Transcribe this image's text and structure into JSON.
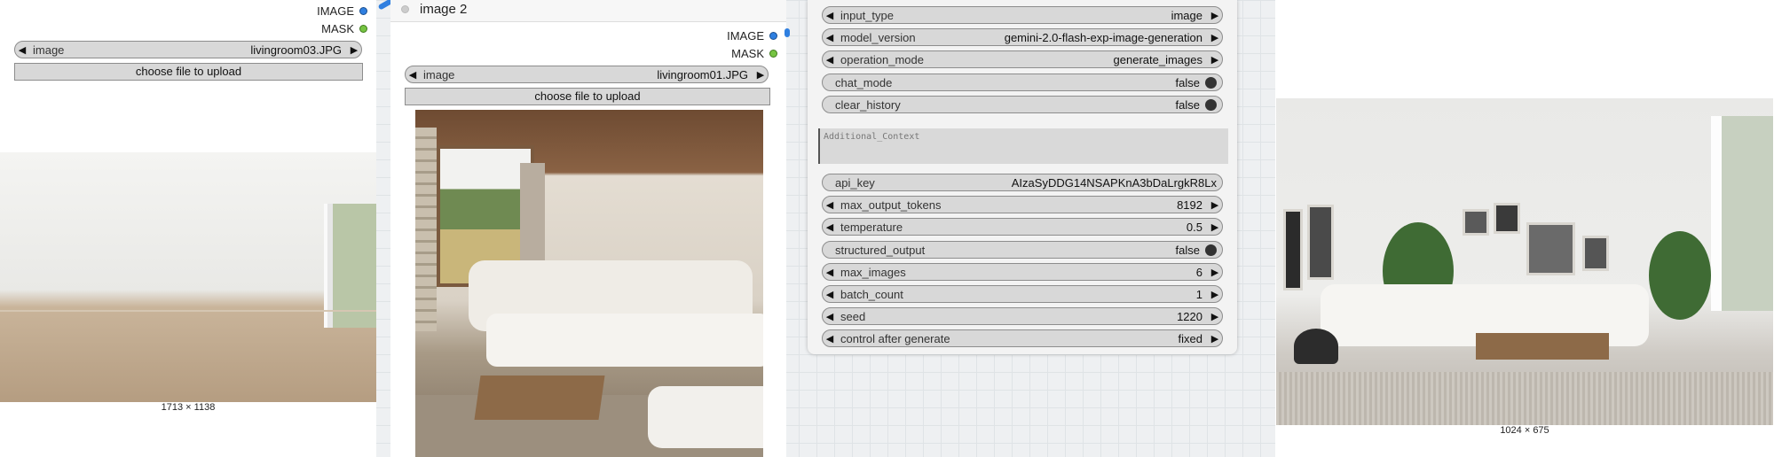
{
  "load_image_1": {
    "outputs": [
      "IMAGE",
      "MASK"
    ],
    "image_widget": {
      "label": "image",
      "value": "livingroom03.JPG"
    },
    "upload_label": "choose file to upload",
    "dimensions": "1713 × 1138"
  },
  "load_image_2": {
    "title": "image 2",
    "outputs": [
      "IMAGE",
      "MASK"
    ],
    "image_widget": {
      "label": "image",
      "value": "livingroom01.JPG"
    },
    "upload_label": "choose file to upload"
  },
  "gemini_node": {
    "widgets": [
      {
        "label": "input_type",
        "value": "image"
      },
      {
        "label": "model_version",
        "value": "gemini-2.0-flash-exp-image-generation"
      },
      {
        "label": "operation_mode",
        "value": "generate_images"
      },
      {
        "label": "chat_mode",
        "value": "false"
      },
      {
        "label": "clear_history",
        "value": "false"
      },
      {
        "label": "api_key",
        "value": "AIzaSyDDG14NSAPKnA3bDaLrgkR8Lx"
      },
      {
        "label": "max_output_tokens",
        "value": "8192"
      },
      {
        "label": "temperature",
        "value": "0.5"
      },
      {
        "label": "structured_output",
        "value": "false"
      },
      {
        "label": "max_images",
        "value": "6"
      },
      {
        "label": "batch_count",
        "value": "1"
      },
      {
        "label": "seed",
        "value": "1220"
      },
      {
        "label": "control after generate",
        "value": "fixed"
      }
    ],
    "additional_context_placeholder": "Additional_Context"
  },
  "preview": {
    "dimensions": "1024 × 675"
  },
  "colors": {
    "image_port": "#2f7fe0",
    "mask_port": "#76c442"
  }
}
